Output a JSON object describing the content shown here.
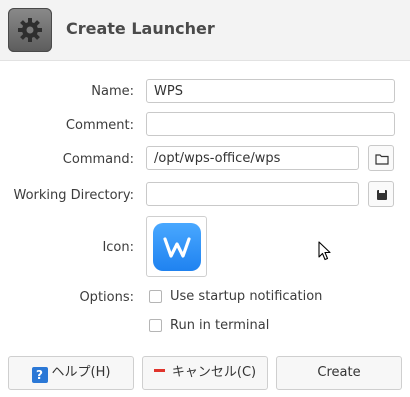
{
  "header": {
    "title": "Create Launcher",
    "app_icon": "gear-icon"
  },
  "form": {
    "name_label": "Name:",
    "name_value": "WPS",
    "comment_label": "Comment:",
    "comment_value": "",
    "command_label": "Command:",
    "command_value": "/opt/wps-office/wps",
    "command_browse_icon": "folder-icon",
    "workdir_label": "Working Directory:",
    "workdir_value": "",
    "workdir_browse_icon": "folder-filled-icon",
    "icon_label": "Icon:",
    "icon_name": "wps-office-icon",
    "options_label": "Options:",
    "options": [
      {
        "label": "Use startup notification",
        "checked": false
      },
      {
        "label": "Run in terminal",
        "checked": false
      }
    ]
  },
  "buttons": {
    "help_label": "ヘルプ(H)",
    "cancel_label": "キャンセル(C)",
    "create_label": "Create"
  },
  "colors": {
    "accent_blue": "#2b78d6",
    "wps_blue": "#3a9bff",
    "cancel_red": "#e0342c"
  }
}
